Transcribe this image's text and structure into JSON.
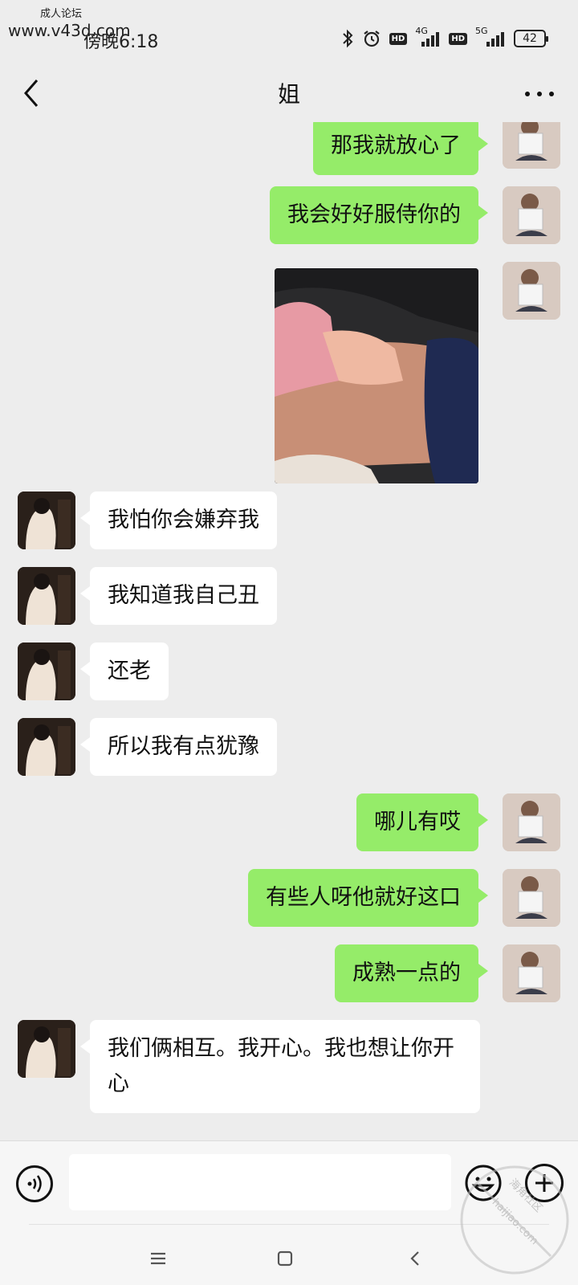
{
  "watermarks": {
    "top_label": "成人论坛",
    "url": "www.v43d.com",
    "corner_name": "海角社区",
    "corner_url": "haijiao.com"
  },
  "status_bar": {
    "time": "傍晚6:18",
    "network_1": "4G",
    "network_2": "5G",
    "hd_badge": "HD",
    "battery": "42"
  },
  "header": {
    "title": "姐",
    "back_icon": "chevron-left-icon",
    "more_icon": "more-dots-icon"
  },
  "messages": [
    {
      "from": "me",
      "type": "text",
      "text": "那我就放心了"
    },
    {
      "from": "me",
      "type": "text",
      "text": "我会好好服侍你的"
    },
    {
      "from": "me",
      "type": "image",
      "text": ""
    },
    {
      "from": "her",
      "type": "text",
      "text": "我怕你会嫌弃我"
    },
    {
      "from": "her",
      "type": "text",
      "text": "我知道我自己丑"
    },
    {
      "from": "her",
      "type": "text",
      "text": "还老"
    },
    {
      "from": "her",
      "type": "text",
      "text": "所以我有点犹豫"
    },
    {
      "from": "me",
      "type": "text",
      "text": "哪儿有哎"
    },
    {
      "from": "me",
      "type": "text",
      "text": "有些人呀他就好这口"
    },
    {
      "from": "me",
      "type": "text",
      "text": "成熟一点的"
    },
    {
      "from": "her",
      "type": "text",
      "text": "我们俩相互。我开心。我也想让你开心"
    }
  ],
  "input_bar": {
    "value": "",
    "voice_icon": "voice-icon",
    "emoji_icon": "emoji-icon",
    "plus_icon": "plus-icon"
  },
  "system_nav": {
    "menu_icon": "menu-icon",
    "home_icon": "home-square-icon",
    "back_icon": "back-triangle-icon"
  },
  "colors": {
    "outgoing_bubble": "#95ec69",
    "incoming_bubble": "#ffffff",
    "chat_background": "#ededed"
  }
}
